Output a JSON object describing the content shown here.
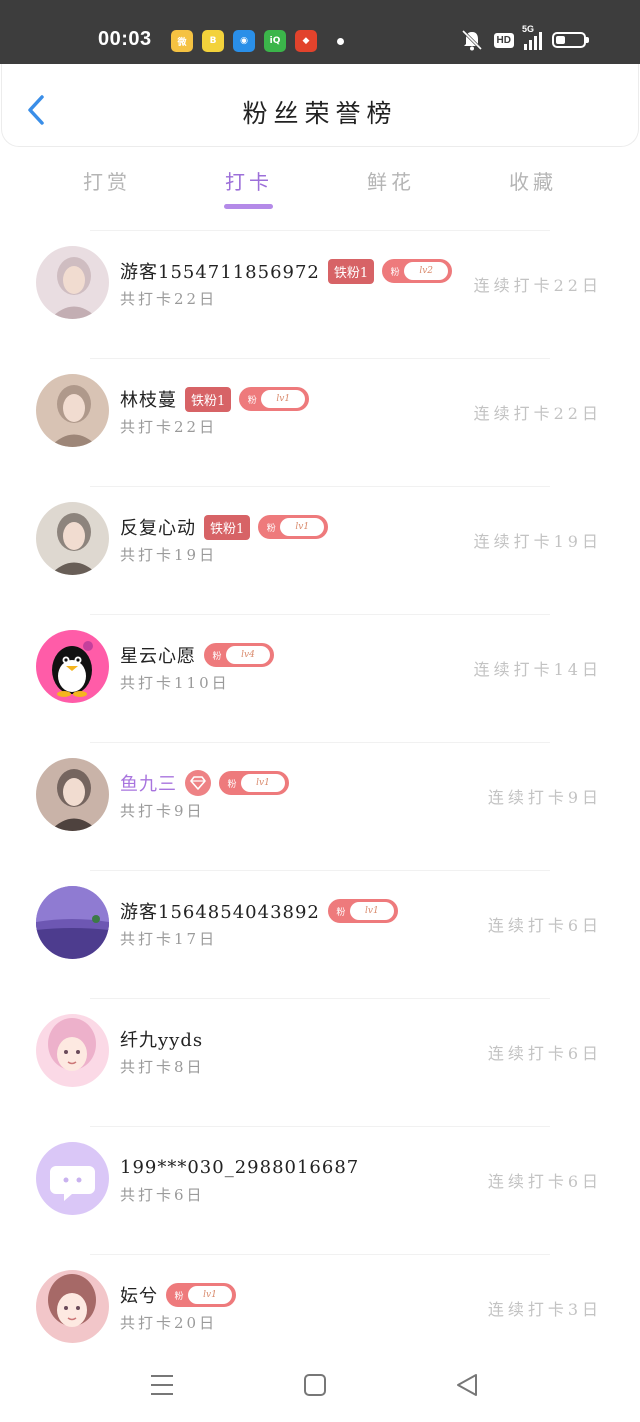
{
  "status_bar": {
    "time": "00:03",
    "app_icons": [
      {
        "name": "weibo-icon",
        "bg": "#f5c242",
        "glyph": "微"
      },
      {
        "name": "bilibili-icon",
        "bg": "#f3d23b",
        "glyph": "B"
      },
      {
        "name": "browser-icon",
        "bg": "#2a8fe8",
        "glyph": "◉"
      },
      {
        "name": "iqiyi-icon",
        "bg": "#3bb54a",
        "glyph": "iQ"
      },
      {
        "name": "red-app-icon",
        "bg": "#e2432c",
        "glyph": "◆"
      }
    ],
    "hd_label": "HD",
    "network_label": "5G",
    "battery_level": 0.35
  },
  "header": {
    "title": "粉丝荣誉榜"
  },
  "tabs": [
    {
      "label": "打赏",
      "active": false
    },
    {
      "label": "打卡",
      "active": true
    },
    {
      "label": "鲜花",
      "active": false
    },
    {
      "label": "收藏",
      "active": false
    }
  ],
  "fan_level_prefix": "粉",
  "fans": [
    {
      "name": "游客1554711856972",
      "badge": "铁粉1",
      "level": "lv2",
      "vip": false,
      "diamond": false,
      "total": "共打卡22日",
      "streak": "连续打卡22日",
      "avatar": "photo-girl-mirror",
      "avatar_colors": [
        "#e9dde1",
        "#b9a3a8"
      ]
    },
    {
      "name": "林枝蔓",
      "badge": "铁粉1",
      "level": "lv1",
      "vip": false,
      "diamond": false,
      "total": "共打卡22日",
      "streak": "连续打卡22日",
      "avatar": "photo-woman-suit",
      "avatar_colors": [
        "#d8c3b4",
        "#8e7769"
      ]
    },
    {
      "name": "反复心动",
      "badge": "铁粉1",
      "level": "lv1",
      "vip": false,
      "diamond": false,
      "total": "共打卡19日",
      "streak": "连续打卡19日",
      "avatar": "photo-man-portrait",
      "avatar_colors": [
        "#ded8d0",
        "#4a4038"
      ]
    },
    {
      "name": "星云心愿",
      "badge": "",
      "level": "lv4",
      "vip": false,
      "diamond": false,
      "total": "共打卡110日",
      "streak": "连续打卡14日",
      "avatar": "penguin-avatar",
      "avatar_colors": [
        "#ff5ca8",
        "#111111"
      ]
    },
    {
      "name": "鱼九三",
      "badge": "",
      "level": "lv1",
      "vip": true,
      "diamond": true,
      "total": "共打卡9日",
      "streak": "连续打卡9日",
      "avatar": "photo-woman-smile",
      "avatar_colors": [
        "#c9b3a8",
        "#2f2523"
      ]
    },
    {
      "name": "游客1564854043892",
      "badge": "",
      "level": "lv1",
      "vip": false,
      "diamond": false,
      "total": "共打卡17日",
      "streak": "连续打卡6日",
      "avatar": "lavender-field",
      "avatar_colors": [
        "#9b7fd6",
        "#4d3c8e"
      ]
    },
    {
      "name": "纤九yyds",
      "badge": "",
      "level": "",
      "vip": false,
      "diamond": false,
      "total": "共打卡8日",
      "streak": "连续打卡6日",
      "avatar": "anime-girl-pink",
      "avatar_colors": [
        "#fbd9e6",
        "#e8a3c2"
      ]
    },
    {
      "name": "199***030_2988016687",
      "badge": "",
      "level": "",
      "vip": false,
      "diamond": false,
      "total": "共打卡6日",
      "streak": "连续打卡6日",
      "avatar": "default-chat-avatar",
      "avatar_colors": [
        "#dac7f7",
        "#ffffff"
      ]
    },
    {
      "name": "妘兮",
      "badge": "",
      "level": "lv1",
      "vip": false,
      "diamond": false,
      "total": "共打卡20日",
      "streak": "连续打卡3日",
      "avatar": "anime-girl-heart",
      "avatar_colors": [
        "#f2c6c9",
        "#8c4a45"
      ]
    }
  ],
  "nav": {
    "menu": "menu-icon",
    "home": "home-icon",
    "back": "back-triangle-icon"
  },
  "colors": {
    "accent": "#9c6fd9",
    "badge_red": "#d76366",
    "level_pink": "#ee7a7c",
    "status_bar": "#3d3d3d"
  }
}
